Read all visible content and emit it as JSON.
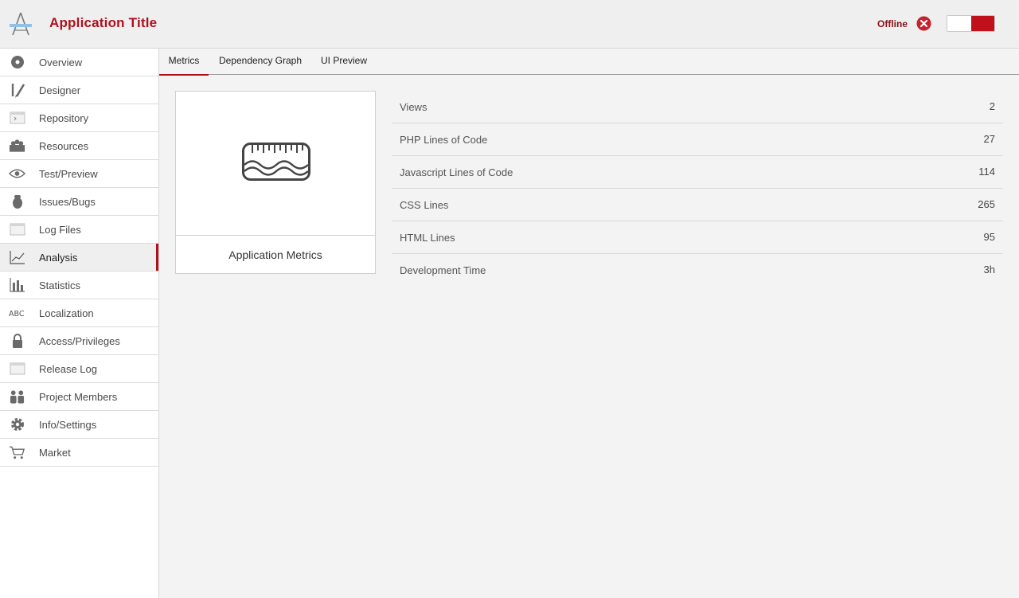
{
  "header": {
    "title": "Application Title",
    "status_text": "Offline",
    "status_icon": "close-circle-icon",
    "brand_color": "#b0101e"
  },
  "sidebar": {
    "items": [
      {
        "label": "Overview",
        "icon": "disc-icon"
      },
      {
        "label": "Designer",
        "icon": "pencil-icon"
      },
      {
        "label": "Repository",
        "icon": "terminal-icon"
      },
      {
        "label": "Resources",
        "icon": "basket-icon"
      },
      {
        "label": "Test/Preview",
        "icon": "eye-icon"
      },
      {
        "label": "Issues/Bugs",
        "icon": "bug-icon"
      },
      {
        "label": "Log Files",
        "icon": "window-icon"
      },
      {
        "label": "Analysis",
        "icon": "line-chart-icon",
        "active": true
      },
      {
        "label": "Statistics",
        "icon": "bar-chart-icon"
      },
      {
        "label": "Localization",
        "icon": "abc-icon"
      },
      {
        "label": "Access/Privileges",
        "icon": "lock-icon"
      },
      {
        "label": "Release Log",
        "icon": "window-icon"
      },
      {
        "label": "Project Members",
        "icon": "people-icon"
      },
      {
        "label": "Info/Settings",
        "icon": "gear-icon"
      },
      {
        "label": "Market",
        "icon": "cart-icon"
      }
    ]
  },
  "tabs": [
    {
      "label": "Metrics",
      "active": true
    },
    {
      "label": "Dependency Graph"
    },
    {
      "label": "UI Preview"
    }
  ],
  "card": {
    "caption": "Application Metrics",
    "icon": "ruler-wave-icon"
  },
  "metrics": [
    {
      "label": "Views",
      "value": "2"
    },
    {
      "label": "PHP Lines of Code",
      "value": "27"
    },
    {
      "label": "Javascript Lines of Code",
      "value": "114"
    },
    {
      "label": "CSS Lines",
      "value": "265"
    },
    {
      "label": "HTML Lines",
      "value": "95"
    },
    {
      "label": "Development Time",
      "value": "3h"
    }
  ]
}
